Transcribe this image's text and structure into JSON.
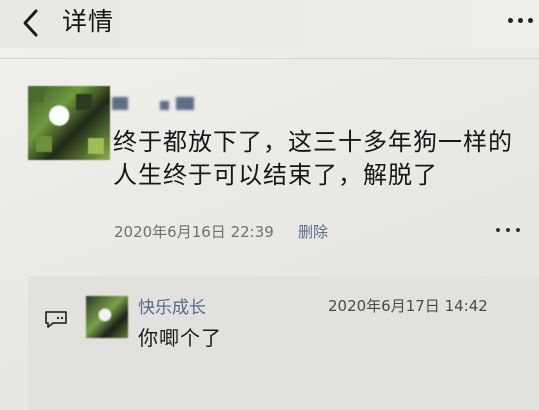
{
  "header": {
    "title": "详情",
    "back_icon": "chevron-left-icon",
    "more_icon": "more-dots-icon"
  },
  "post": {
    "author_name": "",
    "text": "终于都放下了，这三十多年狗一样的人生终于可以结束了，解脱了",
    "timestamp": "2020年6月16日 22:39",
    "delete_label": "删除",
    "comment_icon": "more-dots-icon"
  },
  "comment": {
    "icon": "comment-bubble-icon",
    "author": "快乐成长",
    "timestamp": "2020年6月17日 14:42",
    "text": "你唧个了"
  },
  "colors": {
    "link_blue": "#56698f",
    "background": "#ecebe8",
    "panel": "#e2e1dd"
  }
}
